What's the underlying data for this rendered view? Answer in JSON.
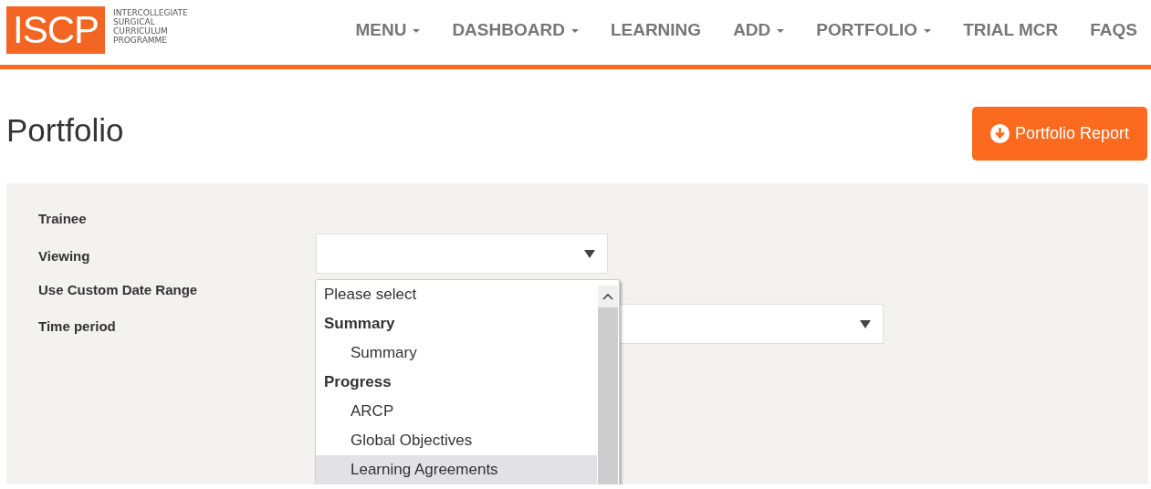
{
  "logo": {
    "mark": "ISCP",
    "lines": [
      "INTERCOLLEGIATE",
      "SURGICAL",
      "CURRICULUM",
      "PROGRAMME"
    ]
  },
  "nav": [
    {
      "label": "MENU",
      "dropdown": true
    },
    {
      "label": "DASHBOARD",
      "dropdown": true
    },
    {
      "label": "LEARNING",
      "dropdown": false
    },
    {
      "label": "ADD",
      "dropdown": true
    },
    {
      "label": "PORTFOLIO",
      "dropdown": true
    },
    {
      "label": "TRIAL MCR",
      "dropdown": false
    },
    {
      "label": "FAQS",
      "dropdown": false
    }
  ],
  "page_title": "Portfolio",
  "report_button": {
    "label": "Portfolio Report"
  },
  "form": {
    "fields": [
      {
        "label": "Trainee",
        "kind": "text"
      },
      {
        "label": "Viewing",
        "kind": "select"
      },
      {
        "label": "Use Custom Date Range",
        "kind": "text"
      },
      {
        "label": "Time period",
        "kind": "select"
      }
    ]
  },
  "viewing_dropdown": {
    "options": [
      {
        "kind": "placeholder",
        "text": "Please select",
        "selected": false
      },
      {
        "kind": "group",
        "text": "Summary",
        "selected": false
      },
      {
        "kind": "option",
        "text": "Summary",
        "selected": false
      },
      {
        "kind": "group",
        "text": "Progress",
        "selected": false
      },
      {
        "kind": "option",
        "text": "ARCP",
        "selected": false
      },
      {
        "kind": "option",
        "text": "Global Objectives",
        "selected": false
      },
      {
        "kind": "option",
        "text": "Learning Agreements",
        "selected": true
      }
    ]
  }
}
